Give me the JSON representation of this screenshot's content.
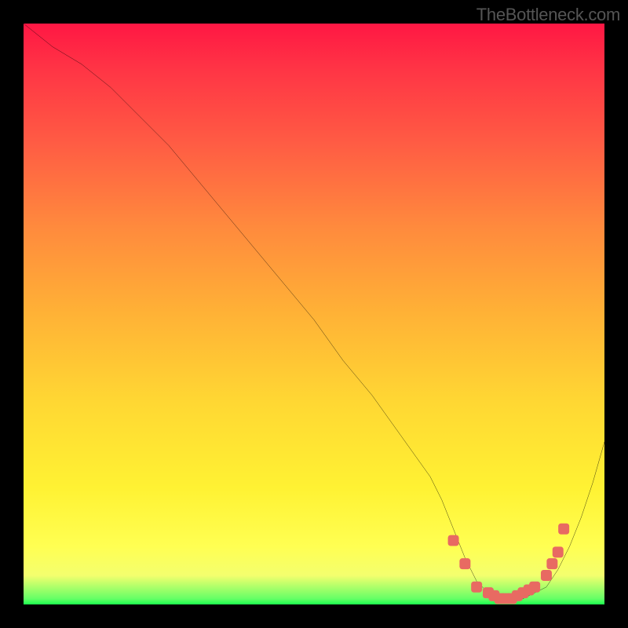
{
  "watermark": "TheBottleneck.com",
  "chart_data": {
    "type": "line",
    "title": "",
    "xlabel": "",
    "ylabel": "",
    "xlim": [
      0,
      100
    ],
    "ylim": [
      0,
      100
    ],
    "background": "heat-gradient",
    "series": [
      {
        "name": "bottleneck-curve",
        "x": [
          0,
          5,
          10,
          15,
          20,
          25,
          30,
          35,
          40,
          45,
          50,
          55,
          60,
          65,
          70,
          72,
          74,
          76,
          78,
          80,
          82,
          84,
          86,
          88,
          90,
          92,
          94,
          96,
          98,
          100
        ],
        "values": [
          100,
          96,
          93,
          89,
          84,
          79,
          73,
          67,
          61,
          55,
          49,
          42,
          36,
          29,
          22,
          18,
          13,
          8,
          4,
          2,
          1,
          1,
          1,
          2,
          3,
          6,
          10,
          15,
          21,
          28
        ],
        "stroke": "#000000",
        "stroke_width": 2
      }
    ],
    "markers": [
      {
        "name": "optimal-zone-dots",
        "color": "#e86a62",
        "points": [
          {
            "x": 74,
            "y": 11
          },
          {
            "x": 76,
            "y": 7
          },
          {
            "x": 78,
            "y": 3
          },
          {
            "x": 80,
            "y": 2
          },
          {
            "x": 81,
            "y": 1.5
          },
          {
            "x": 82,
            "y": 1
          },
          {
            "x": 83,
            "y": 1
          },
          {
            "x": 84,
            "y": 1
          },
          {
            "x": 85,
            "y": 1.5
          },
          {
            "x": 86,
            "y": 2
          },
          {
            "x": 87,
            "y": 2.5
          },
          {
            "x": 88,
            "y": 3
          },
          {
            "x": 90,
            "y": 5
          },
          {
            "x": 91,
            "y": 7
          },
          {
            "x": 92,
            "y": 9
          },
          {
            "x": 93,
            "y": 13
          }
        ],
        "size": 7
      }
    ]
  }
}
